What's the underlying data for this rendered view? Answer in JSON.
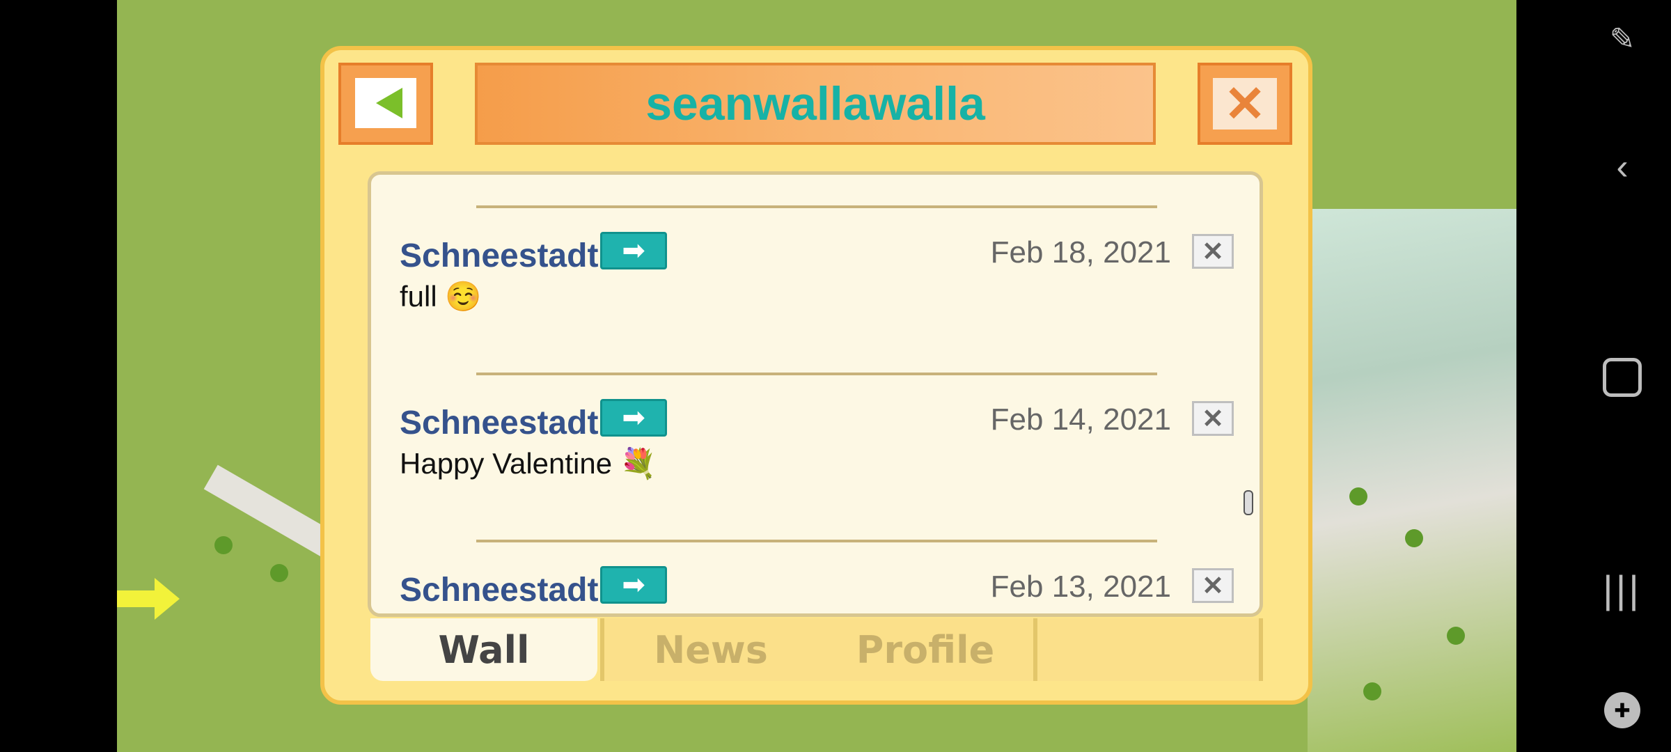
{
  "dialog": {
    "title": "seanwallawalla",
    "back_label": "back",
    "close_label": "close"
  },
  "posts": [
    {
      "author": "Schneestadt",
      "date": "Feb 18, 2021",
      "message": "full ☺️"
    },
    {
      "author": "Schneestadt",
      "date": "Feb 14, 2021",
      "message": "Happy Valentine 💐"
    },
    {
      "author": "Schneestadt",
      "date": "Feb 13, 2021",
      "message": ""
    }
  ],
  "tabs": [
    "Wall",
    "News",
    "Profile",
    ""
  ],
  "navbar": {
    "icons": [
      "screenshot-touch-icon",
      "back-icon",
      "home-icon",
      "recents-icon",
      "game-tools-icon"
    ]
  },
  "colors": {
    "title": "#17b2a6",
    "author": "#35528c",
    "panel": "#fde58a",
    "button_orange": "#f6a04f"
  }
}
